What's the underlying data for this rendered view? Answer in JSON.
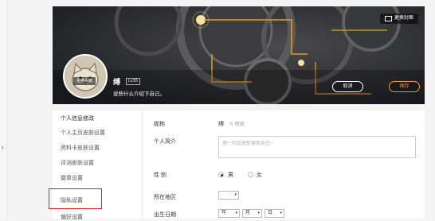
{
  "banner": {
    "change_cover_label": "更换封面",
    "avatar_change_label": "更换头像",
    "username": "缚",
    "level": "Lv.55",
    "intro": "说些什么介绍下自己。",
    "cancel_label": "取消",
    "save_label": "保存",
    "accent_color": "#f0a020"
  },
  "sidebar": {
    "items": [
      {
        "label": "个人信息修改"
      },
      {
        "label": "个人主页皮肤设置"
      },
      {
        "label": "资料卡皮肤设置"
      },
      {
        "label": "评测皮肤设置"
      },
      {
        "label": "徽章设置"
      },
      {
        "label": "隐私设置"
      },
      {
        "label": "偏好设置"
      }
    ],
    "highlight_color": "#d72020"
  },
  "form": {
    "nickname_label": "昵称",
    "nickname_value": "缚",
    "edit_label": "✎ 修改",
    "intro_label": "个人简介",
    "intro_placeholder": "用一句话来形容你自己~",
    "gender_label": "性 别",
    "gender_male": "男",
    "gender_female": "女",
    "region_label": "所在地区",
    "birth_label": "出生日期",
    "year_label": "年",
    "month_label": "月",
    "day_label": "日"
  }
}
